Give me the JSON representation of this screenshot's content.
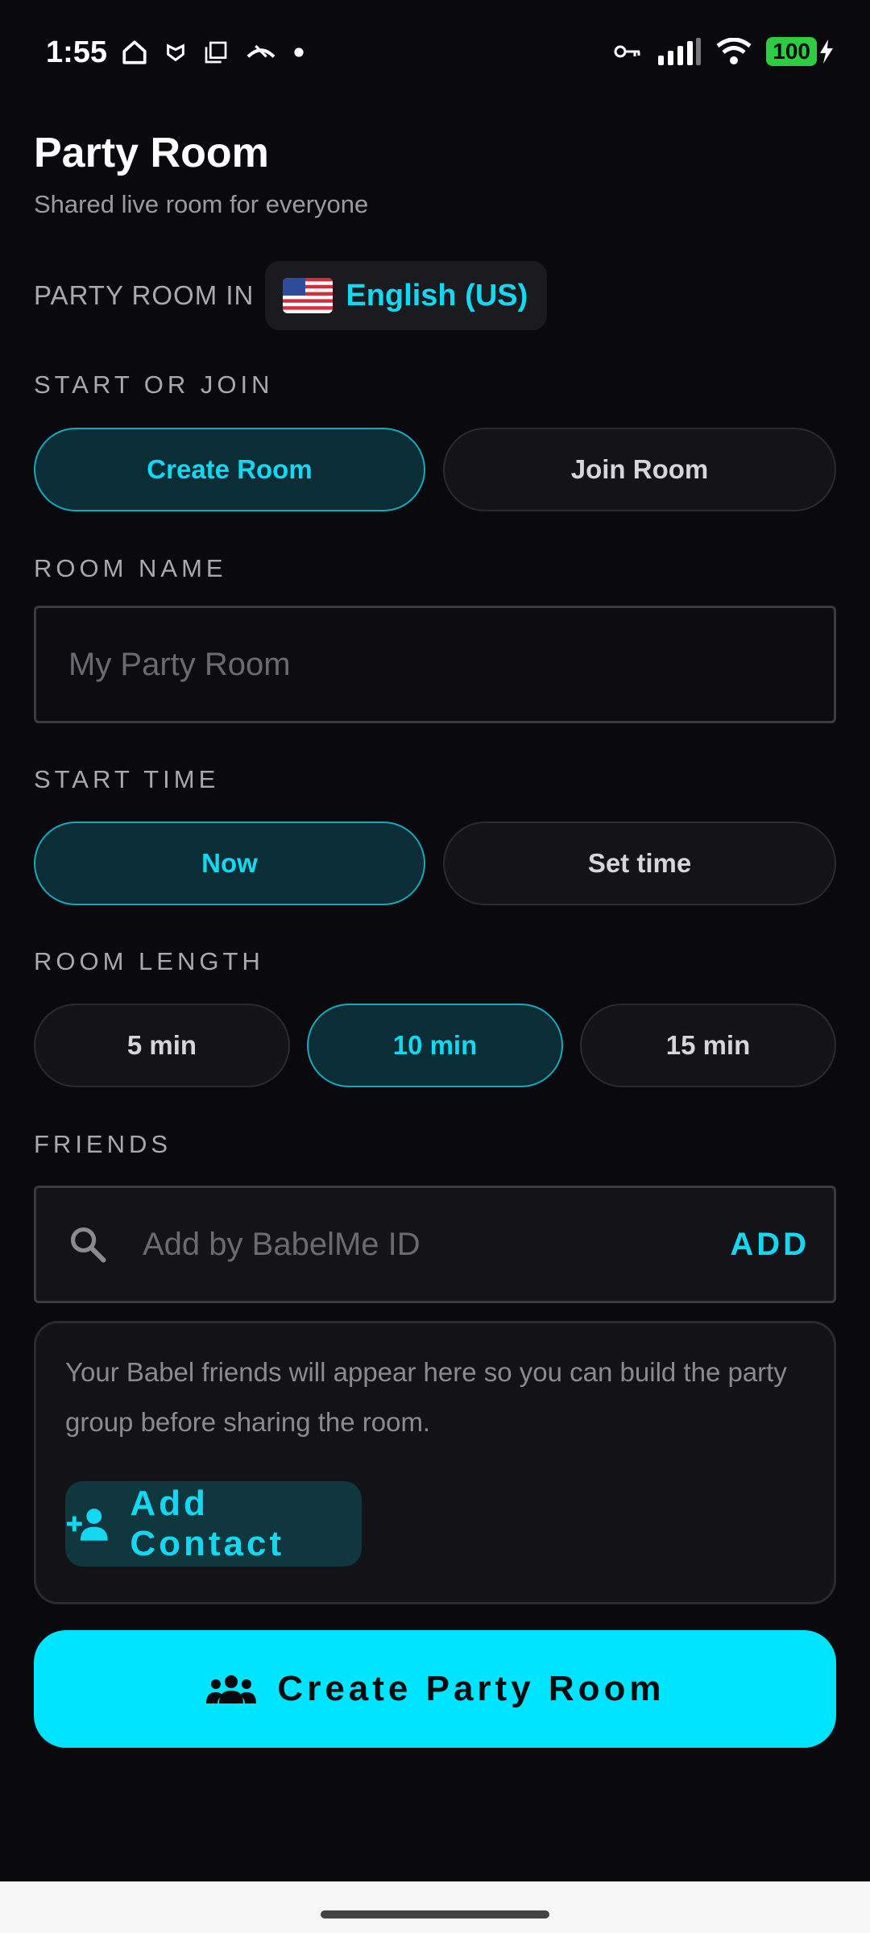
{
  "status_bar": {
    "time": "1:55",
    "battery": "100",
    "icons_left": [
      "home-icon",
      "shield-icon",
      "copy-icon",
      "call-end-icon",
      "dot-icon"
    ],
    "icons_right": [
      "key-icon",
      "signal-icon",
      "wifi-icon",
      "battery-icon"
    ]
  },
  "header": {
    "title": "Party Room",
    "subtitle": "Shared live room for everyone"
  },
  "language": {
    "label": "PARTY ROOM IN",
    "value": "English (US)",
    "flag_icon": "us-flag-icon"
  },
  "start_or_join": {
    "label": "START OR JOIN",
    "options": [
      "Create Room",
      "Join Room"
    ],
    "selected": "Create Room"
  },
  "room_name": {
    "label": "ROOM NAME",
    "placeholder": "My Party Room",
    "value": ""
  },
  "start_time": {
    "label": "START TIME",
    "options": [
      "Now",
      "Set time"
    ],
    "selected": "Now"
  },
  "room_length": {
    "label": "ROOM LENGTH",
    "options": [
      "5 min",
      "10 min",
      "15 min"
    ],
    "selected": "10 min"
  },
  "friends": {
    "label": "FRIENDS",
    "search_placeholder": "Add by BabelMe ID",
    "add_label": "ADD",
    "description": "Your Babel friends will appear here so you can build the party group before sharing the room.",
    "add_contact_label": "Add Contact"
  },
  "primary_action": {
    "label": "Create Party Room"
  },
  "colors": {
    "accent": "#00e5ff",
    "accent_text": "#14d8f0",
    "background": "#0a0a0e",
    "selected_bg": "#0b2e36"
  }
}
